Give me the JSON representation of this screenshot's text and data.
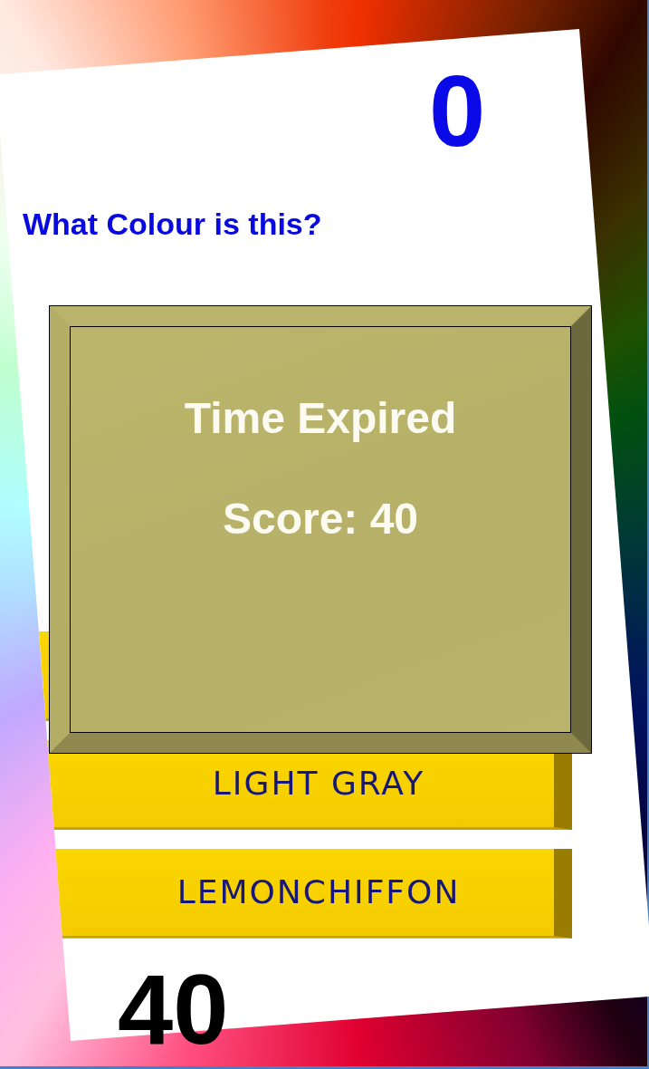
{
  "timer": "0",
  "question": "What Colour is this?",
  "answers": [
    {
      "kind": "covered"
    },
    {
      "kind": "visible",
      "label": "LIGHT GRAY"
    },
    {
      "kind": "visible",
      "label": "LEMONCHIFFON"
    }
  ],
  "score": "40",
  "result_panel": {
    "title": "Time Expired",
    "message": "Score: 40"
  }
}
